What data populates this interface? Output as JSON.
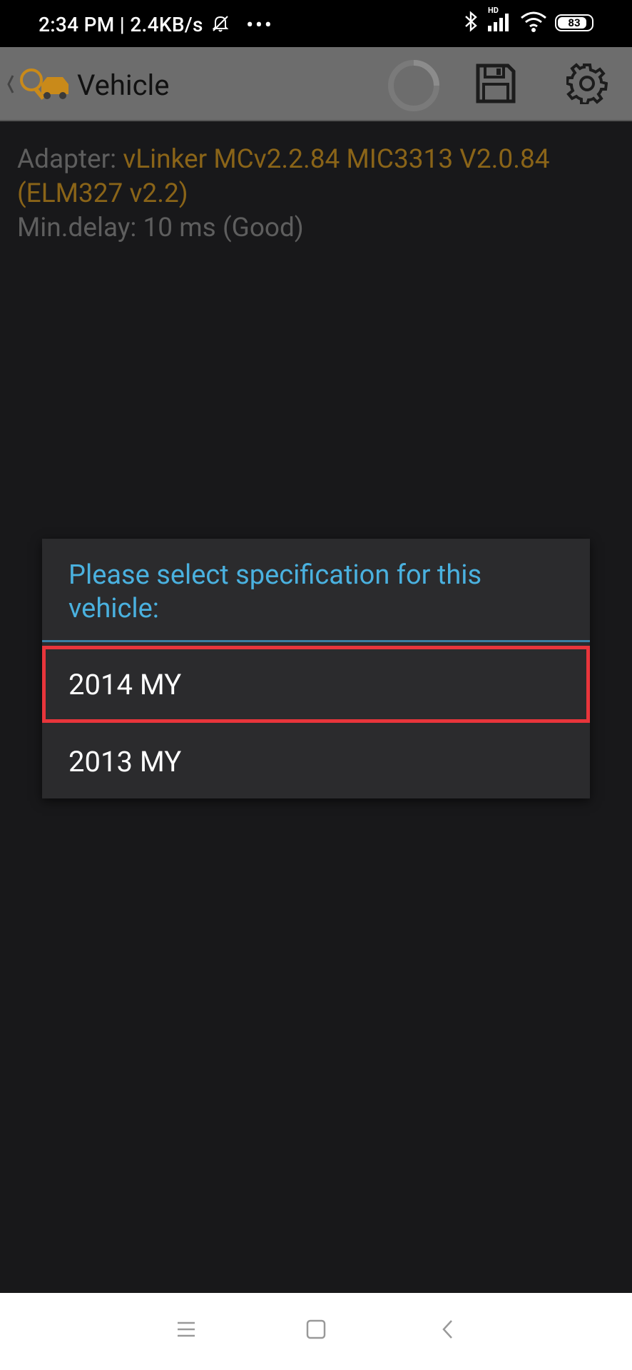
{
  "status": {
    "time_speed": "2:34 PM | 2.4KB/s",
    "network_badge": "HD",
    "battery": "83"
  },
  "app_bar": {
    "title": "Vehicle"
  },
  "content": {
    "adapter_label": "Adapter: ",
    "adapter_value": "vLinker MCv2.2.84 MIC3313 V2.0.84 (ELM327 v2.2)",
    "min_delay": "Min.delay: 10 ms (Good)"
  },
  "dialog": {
    "title": "Please select specification for this vehicle:",
    "options": [
      {
        "label": "2014 MY"
      },
      {
        "label": "2013 MY"
      }
    ]
  },
  "colors": {
    "accent_blue": "#4ab1df",
    "highlight_red": "#e8353b",
    "adapter_orange": "#8a6418"
  }
}
